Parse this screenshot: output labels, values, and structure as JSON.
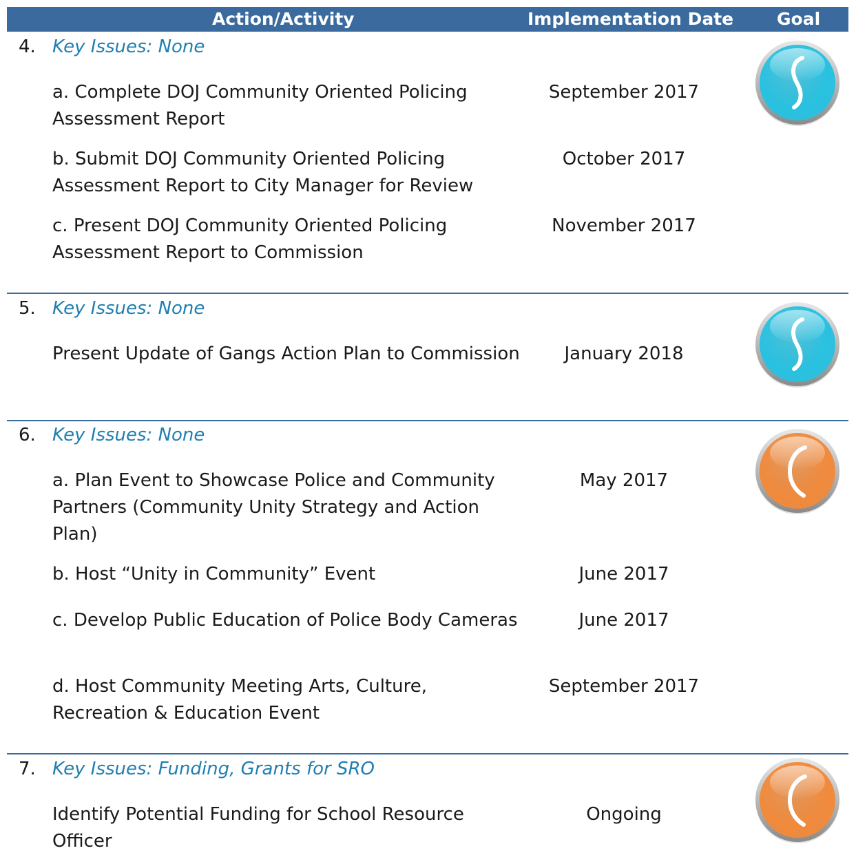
{
  "header": {
    "action": "Action/Activity",
    "date": "Implementation Date",
    "goal": "Goal"
  },
  "sections": [
    {
      "number": "4.",
      "key_issues": "Key Issues:  None",
      "goal_color": "#29c1e0",
      "goal_icon": "status-circle-s-icon",
      "items": [
        {
          "text": "a.  Complete DOJ Community Oriented Policing Assessment Report",
          "date": "September 2017"
        },
        {
          "text": "b.  Submit DOJ Community Oriented Policing Assessment Report to City Manager for Review",
          "date": "October 2017"
        },
        {
          "text": "c.   Present DOJ Community Oriented Policing Assessment Report to Commission",
          "date": "November 2017"
        }
      ]
    },
    {
      "number": "5.",
      "key_issues": "Key Issues:  None",
      "goal_color": "#29c1e0",
      "goal_icon": "status-circle-s-icon",
      "items": [
        {
          "text": "Present Update of Gangs Action Plan to Commission",
          "date": "January  2018"
        }
      ]
    },
    {
      "number": "6.",
      "key_issues": "Key Issues:  None",
      "goal_color": "#f08a3c",
      "goal_icon": "status-circle-c-icon",
      "items": [
        {
          "text": "a.   Plan Event to Showcase Police and Community Partners (Community Unity Strategy and Action Plan)",
          "date": "May 2017"
        },
        {
          "text": "b.   Host “Unity in Community” Event",
          "date": "June 2017"
        },
        {
          "text": "c.  Develop Public Education of Police Body Cameras",
          "date": "June 2017"
        },
        {
          "text": "d.  Host Community Meeting Arts, Culture, Recreation & Education Event",
          "date": "September 2017"
        }
      ]
    },
    {
      "number": "7.",
      "key_issues": "Key Issues:  Funding, Grants for SRO",
      "goal_color": "#f08a3c",
      "goal_icon": "status-circle-c-icon",
      "items": [
        {
          "text": "Identify Potential Funding for School Resource Officer",
          "date": "Ongoing"
        }
      ]
    }
  ]
}
